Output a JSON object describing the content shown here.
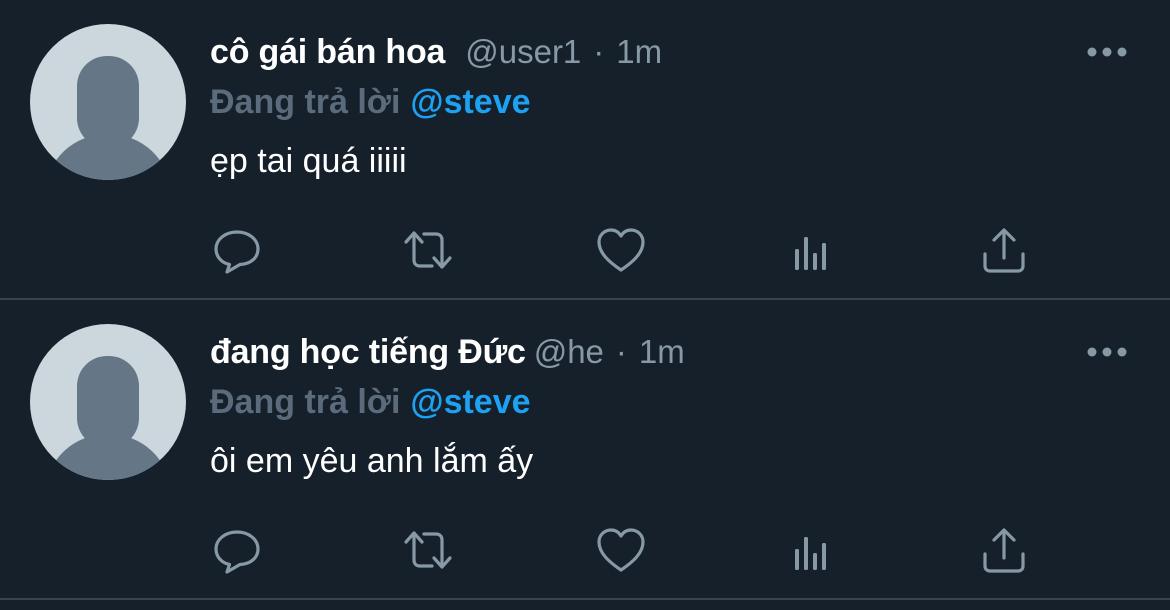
{
  "tweets": [
    {
      "display_name": "cô gái bán hoa",
      "handle": "@user1",
      "separator": "·",
      "time": "1m",
      "reply_prefix": "Đang trả lời",
      "reply_to": "@steve",
      "text": "ẹp tai quá iiiii",
      "actions": [
        "reply-icon",
        "retweet-icon",
        "like-icon",
        "analytics-icon",
        "share-icon"
      ]
    },
    {
      "display_name": "đang học tiếng Đức",
      "handle": "@he",
      "separator": "·",
      "time": "1m",
      "reply_prefix": "Đang trả lời",
      "reply_to": "@steve",
      "text": "ôi em yêu anh lắm ấy",
      "actions": [
        "reply-icon",
        "retweet-icon",
        "like-icon",
        "analytics-icon",
        "share-icon"
      ]
    }
  ],
  "colors": {
    "background": "#15202b",
    "text_primary": "#ffffff",
    "text_secondary": "#8899a6",
    "mention": "#1da1f2",
    "divider": "#38444d",
    "avatar_bg": "#ccd6dd",
    "avatar_fg": "#657786"
  }
}
